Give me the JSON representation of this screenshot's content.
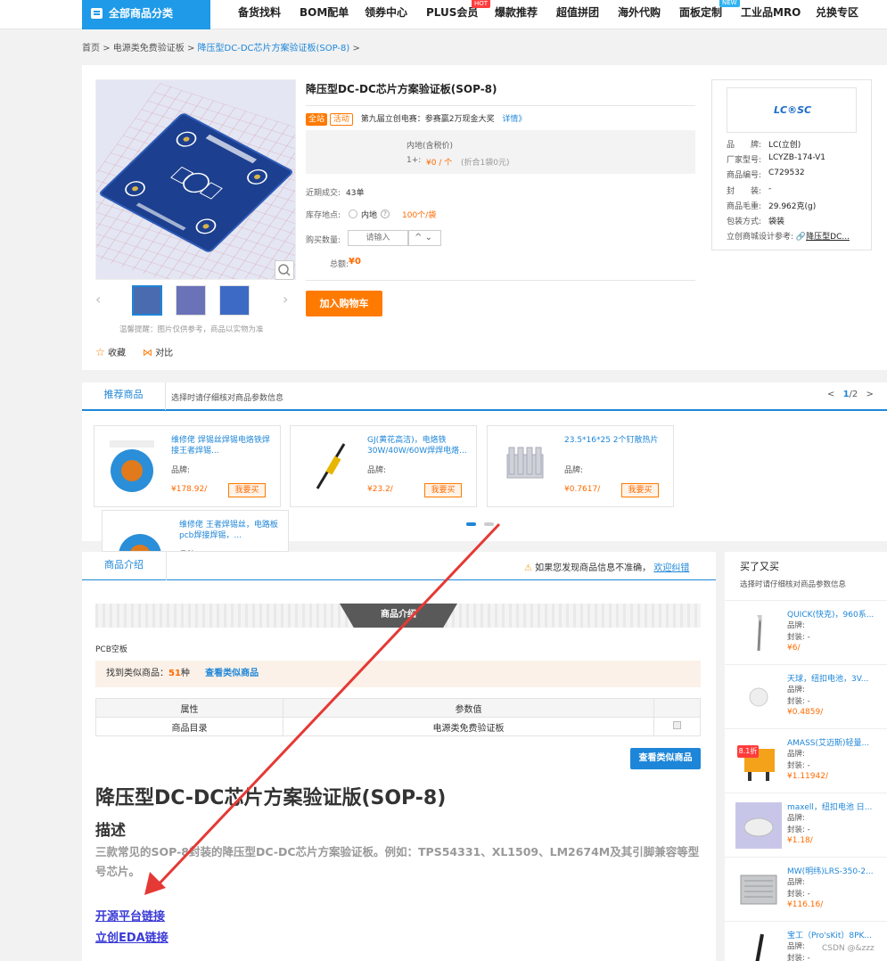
{
  "nav": {
    "category_button": "全部商品分类",
    "items": [
      {
        "label": "备货找料"
      },
      {
        "label": "BOM配单"
      },
      {
        "label": "领券中心"
      },
      {
        "label": "PLUS会员",
        "badge": "HOT"
      },
      {
        "label": "爆款推荐"
      },
      {
        "label": "超值拼团"
      },
      {
        "label": "海外代购"
      },
      {
        "label": "面板定制",
        "badge": "NEW"
      },
      {
        "label": "工业品MRO"
      },
      {
        "label": "兑换专区"
      }
    ]
  },
  "breadcrumb": {
    "home": "首页",
    "sep": ">",
    "category": "电源类免费验证板",
    "current": "降压型DC-DC芯片方案验证板(SOP-8)"
  },
  "product": {
    "title": "降压型DC-DC芯片方案验证板(SOP-8)",
    "tag_all": "全站",
    "tag_event": "活动",
    "promo_text": "第九届立创电赛：参赛赢2万现金大奖",
    "promo_link": "详情》",
    "price_header": "内地(含税价)",
    "price_qty": "1+:",
    "price_value": "¥0 / 个",
    "price_note": "(折合1袋0元)",
    "recent_label": "近期成交:",
    "recent_value": "43单",
    "stock_label": "库存地点:",
    "stock_location": "内地",
    "stock_value": "100个/袋",
    "qty_label": "购买数量:",
    "qty_placeholder": "请输入",
    "total_label": "总额:",
    "total_value": "¥0",
    "add_cart": "加入购物车",
    "image_note": "温馨提醒：图片仅供参考，商品以实物为准",
    "favorite": "收藏",
    "compare": "对比"
  },
  "specs": {
    "logo_text": "LC®SC",
    "rows": [
      {
        "label": "品　　牌:",
        "value": "LC(立创)"
      },
      {
        "label": "厂家型号:",
        "value": "LCYZB-174-V1"
      },
      {
        "label": "商品编号:",
        "value": "C729532"
      },
      {
        "label": "封　　装:",
        "value": "-"
      },
      {
        "label": "商品毛重:",
        "value": "29.962克(g)"
      },
      {
        "label": "包装方式:",
        "value": "袋装"
      },
      {
        "label": "立创商城设计参考:",
        "value": "降压型DC..."
      }
    ]
  },
  "recommend": {
    "tab": "推荐商品",
    "hint": "选择时请仔细核对商品参数信息",
    "page_prev": "<",
    "page_current": "1",
    "page_sep": "/2",
    "page_next": ">",
    "brand_label": "品牌:",
    "buy_label": "我要买",
    "cards": [
      {
        "name": "维修佬 焊锡丝焊锡电烙铁焊接王者焊锡...",
        "price": "¥178.92/"
      },
      {
        "name": "GJ(黄花高洁)，电烙铁30W/40W/60W焊焊电烙...",
        "price": "¥23.2/"
      },
      {
        "name": "23.5*16*25 2个钉散热片",
        "price": "¥0.7617/"
      },
      {
        "name": "维修佬 王者焊锡丝，电路板pcb焊接焊锡，...",
        "price": ""
      }
    ]
  },
  "intro": {
    "tab": "商品介绍",
    "notice": "如果您发现商品信息不准确，",
    "notice_link": "欢迎纠错",
    "banner_label": "商品介绍",
    "category_text": "PCB空板",
    "find_label": "找到类似商品：",
    "find_count": "51",
    "find_unit": "种",
    "find_link": "查看类似商品",
    "table_header_attr": "属性",
    "table_header_value": "参数值",
    "row_attr": "商品目录",
    "row_value": "电源类免费验证板",
    "similar_button": "查看类似商品",
    "heading": "降压型DC-DC芯片方案验证版(SOP-8)",
    "subheading": "描述",
    "description": "三款常见的SOP-8封装的降压型DC-DC芯片方案验证板。例如：TPS54331、XL1509、LM2674M及其引脚兼容等型号芯片。",
    "link_open": "开源平台链接",
    "link_eda": "立创EDA链接"
  },
  "also_bought": {
    "title": "买了又买",
    "hint": "选择时请仔细核对商品参数信息",
    "brand_label": "品牌:",
    "package_label": "封装:",
    "package_value": "-",
    "items": [
      {
        "name": "QUICK(快克)，960系...",
        "price": "¥6/"
      },
      {
        "name": "天球，纽扣电池，3V...",
        "price": "¥0.4859/"
      },
      {
        "name": "AMASS(艾迈斯)轻量...",
        "price": "¥1.11942/",
        "badge": "8.1折"
      },
      {
        "name": "maxell，纽扣电池 日...",
        "price": "¥1.18/"
      },
      {
        "name": "MW(明纬)LRS-350-2...",
        "price": "¥116.16/"
      },
      {
        "name": "宝工（Pro'sKit）8PK...",
        "price": ""
      }
    ]
  },
  "watermark": "CSDN @&zzz",
  "colors": {
    "accent": "#1e86d8",
    "orange": "#ff7a00",
    "arrow": "#e53935"
  }
}
